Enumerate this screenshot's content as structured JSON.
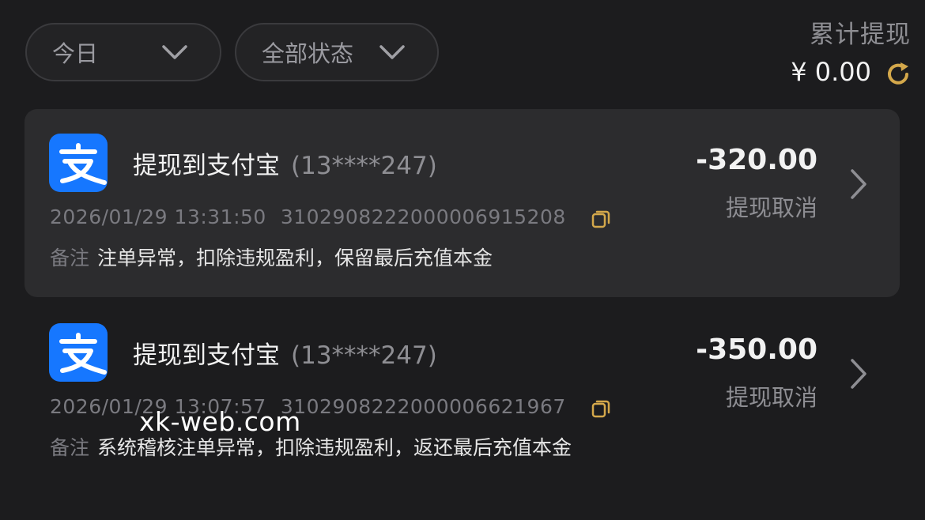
{
  "filters": {
    "date": {
      "label": "今日"
    },
    "status": {
      "label": "全部状态"
    }
  },
  "summary": {
    "title": "累计提现",
    "amount": "¥ 0.00"
  },
  "records": [
    {
      "title": "提现到支付宝",
      "account": "(13****247)",
      "amount": "-320.00",
      "status": "提现取消",
      "datetime": "2026/01/29 13:31:50",
      "order_no": "3102908222000006915208",
      "note_label": "备注",
      "note": "注单异常，扣除违规盈利，保留最后充值本金"
    },
    {
      "title": "提现到支付宝",
      "account": "(13****247)",
      "amount": "-350.00",
      "status": "提现取消",
      "datetime": "2026/01/29 13:07:57",
      "order_no": "3102908222000006621967",
      "note_label": "备注",
      "note": "系统稽核注单异常，扣除违规盈利，返还最后充值本金"
    }
  ],
  "watermark": "xk-web.com",
  "icons": {
    "logo": "alipay-logo-icon",
    "chevron_down": "chevron-down-icon",
    "chevron_right": "chevron-right-icon",
    "copy": "copy-icon",
    "refresh": "refresh-icon"
  },
  "colors": {
    "background": "#1c1c1e",
    "card": "#2c2c2e",
    "alipay_blue": "#1677ff",
    "accent_gold": "#d4a84b"
  }
}
